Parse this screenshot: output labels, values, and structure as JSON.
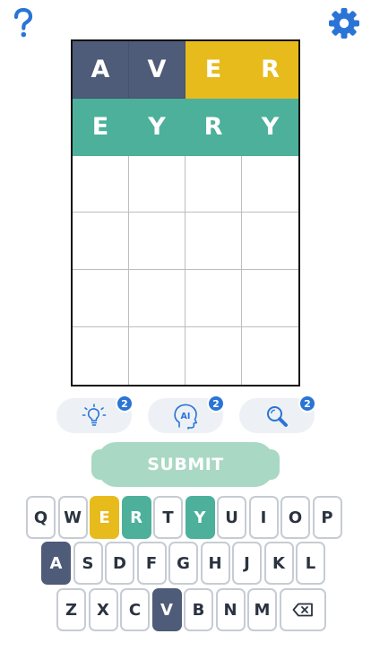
{
  "header": {
    "help_icon": "question-mark-icon",
    "settings_icon": "gear-icon"
  },
  "colors": {
    "absent": "#4e5b79",
    "present": "#e8bb1c",
    "correct": "#4cb09b",
    "accent": "#2a74d6",
    "submit": "#a9d8c4"
  },
  "board": {
    "rows": [
      [
        {
          "letter": "A",
          "state": "absent"
        },
        {
          "letter": "V",
          "state": "absent"
        },
        {
          "letter": "E",
          "state": "present"
        },
        {
          "letter": "R",
          "state": "present"
        }
      ],
      [
        {
          "letter": "E",
          "state": "correct"
        },
        {
          "letter": "Y",
          "state": "correct"
        },
        {
          "letter": "R",
          "state": "correct"
        },
        {
          "letter": "Y",
          "state": "correct"
        }
      ],
      [
        {
          "letter": "",
          "state": "empty"
        },
        {
          "letter": "",
          "state": "empty"
        },
        {
          "letter": "",
          "state": "empty"
        },
        {
          "letter": "",
          "state": "empty"
        }
      ],
      [
        {
          "letter": "",
          "state": "empty"
        },
        {
          "letter": "",
          "state": "empty"
        },
        {
          "letter": "",
          "state": "empty"
        },
        {
          "letter": "",
          "state": "empty"
        }
      ],
      [
        {
          "letter": "",
          "state": "empty"
        },
        {
          "letter": "",
          "state": "empty"
        },
        {
          "letter": "",
          "state": "empty"
        },
        {
          "letter": "",
          "state": "empty"
        }
      ],
      [
        {
          "letter": "",
          "state": "empty"
        },
        {
          "letter": "",
          "state": "empty"
        },
        {
          "letter": "",
          "state": "empty"
        },
        {
          "letter": "",
          "state": "empty"
        }
      ]
    ]
  },
  "powerups": [
    {
      "name": "hint",
      "icon": "lightbulb-icon",
      "count": "2"
    },
    {
      "name": "ai",
      "icon": "ai-head-icon",
      "label": "AI",
      "count": "2"
    },
    {
      "name": "search",
      "icon": "magnifier-icon",
      "count": "2"
    }
  ],
  "submit": {
    "label": "SUBMIT"
  },
  "keyboard": {
    "rows": [
      [
        {
          "key": "Q",
          "state": ""
        },
        {
          "key": "W",
          "state": ""
        },
        {
          "key": "E",
          "state": "present"
        },
        {
          "key": "R",
          "state": "correct"
        },
        {
          "key": "T",
          "state": ""
        },
        {
          "key": "Y",
          "state": "correct"
        },
        {
          "key": "U",
          "state": ""
        },
        {
          "key": "I",
          "state": ""
        },
        {
          "key": "O",
          "state": ""
        },
        {
          "key": "P",
          "state": ""
        }
      ],
      [
        {
          "key": "A",
          "state": "absent"
        },
        {
          "key": "S",
          "state": ""
        },
        {
          "key": "D",
          "state": ""
        },
        {
          "key": "F",
          "state": ""
        },
        {
          "key": "G",
          "state": ""
        },
        {
          "key": "H",
          "state": ""
        },
        {
          "key": "J",
          "state": ""
        },
        {
          "key": "K",
          "state": ""
        },
        {
          "key": "L",
          "state": ""
        }
      ],
      [
        {
          "key": "Z",
          "state": ""
        },
        {
          "key": "X",
          "state": ""
        },
        {
          "key": "C",
          "state": ""
        },
        {
          "key": "V",
          "state": "absent"
        },
        {
          "key": "B",
          "state": ""
        },
        {
          "key": "N",
          "state": ""
        },
        {
          "key": "M",
          "state": ""
        }
      ]
    ],
    "backspace_icon": "backspace-icon"
  }
}
